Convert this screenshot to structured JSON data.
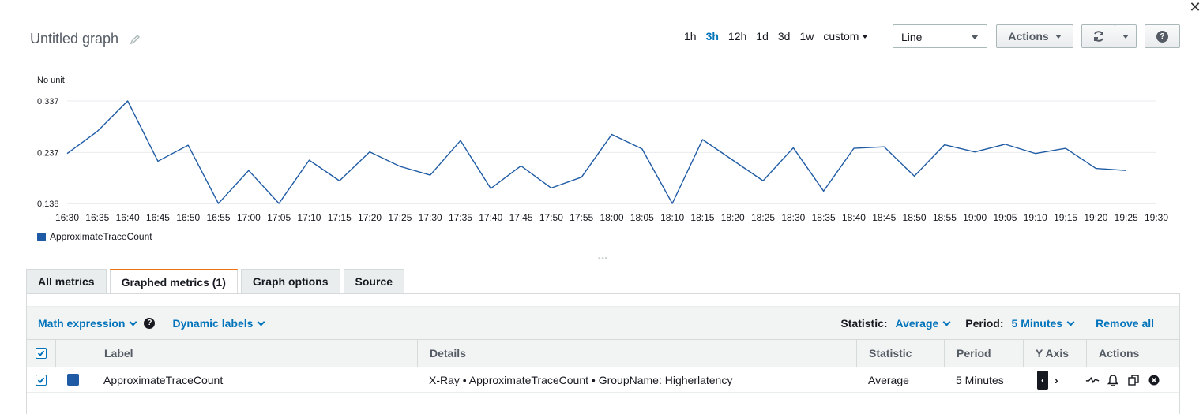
{
  "window": {
    "close_glyph": "✕"
  },
  "graph": {
    "title": "Untitled graph",
    "edit_icon": "pencil-icon"
  },
  "time_range": {
    "options": [
      "1h",
      "3h",
      "12h",
      "1d",
      "3d",
      "1w"
    ],
    "selected": "3h",
    "custom_label": "custom"
  },
  "chart_type_select": {
    "value": "Line"
  },
  "toolbar": {
    "actions_label": "Actions",
    "refresh_icon": "refresh-icon",
    "help_label": "?"
  },
  "chart_data": {
    "type": "line",
    "unit_label": "No unit",
    "x": [
      "16:30",
      "16:35",
      "16:40",
      "16:45",
      "16:50",
      "16:55",
      "17:00",
      "17:05",
      "17:10",
      "17:15",
      "17:20",
      "17:25",
      "17:30",
      "17:35",
      "17:40",
      "17:45",
      "17:50",
      "17:55",
      "18:00",
      "18:05",
      "18:10",
      "18:15",
      "18:20",
      "18:25",
      "18:30",
      "18:35",
      "18:40",
      "18:45",
      "18:50",
      "18:55",
      "19:00",
      "19:05",
      "19:10",
      "19:15",
      "19:20",
      "19:25",
      "19:30"
    ],
    "y_ticks": [
      "0.138",
      "0.237",
      "0.337"
    ],
    "ylim": [
      0.138,
      0.337
    ],
    "grid": true,
    "legend": "bottom-left",
    "series": [
      {
        "name": "ApproximateTraceCount",
        "color": "#1f5ba5",
        "values": [
          0.235,
          0.278,
          0.337,
          0.22,
          0.251,
          0.138,
          0.202,
          0.138,
          0.222,
          0.182,
          0.238,
          0.21,
          0.193,
          0.26,
          0.167,
          0.211,
          0.168,
          0.189,
          0.272,
          0.244,
          0.138,
          0.262,
          0.222,
          0.182,
          0.246,
          0.162,
          0.245,
          0.248,
          0.191,
          0.252,
          0.238,
          0.253,
          0.235,
          0.245,
          0.206,
          0.202,
          null
        ]
      }
    ]
  },
  "splitter": {
    "glyph": "---"
  },
  "tabs": [
    {
      "label": "All metrics",
      "active": false
    },
    {
      "label": "Graphed metrics (1)",
      "active": true
    },
    {
      "label": "Graph options",
      "active": false
    },
    {
      "label": "Source",
      "active": false
    }
  ],
  "metrics_toolbar": {
    "math_expression": "Math expression",
    "dynamic_labels": "Dynamic labels",
    "statistic_label": "Statistic:",
    "statistic_value": "Average",
    "period_label": "Period:",
    "period_value": "5 Minutes",
    "remove_all": "Remove all"
  },
  "table": {
    "headers": {
      "label": "Label",
      "details": "Details",
      "statistic": "Statistic",
      "period": "Period",
      "yaxis": "Y Axis",
      "actions": "Actions"
    },
    "rows": [
      {
        "checked": true,
        "color": "#1f5ba5",
        "label": "ApproximateTraceCount",
        "details": "X-Ray • ApproximateTraceCount • GroupName: Higherlatency",
        "statistic": "Average",
        "period": "5 Minutes"
      }
    ]
  }
}
